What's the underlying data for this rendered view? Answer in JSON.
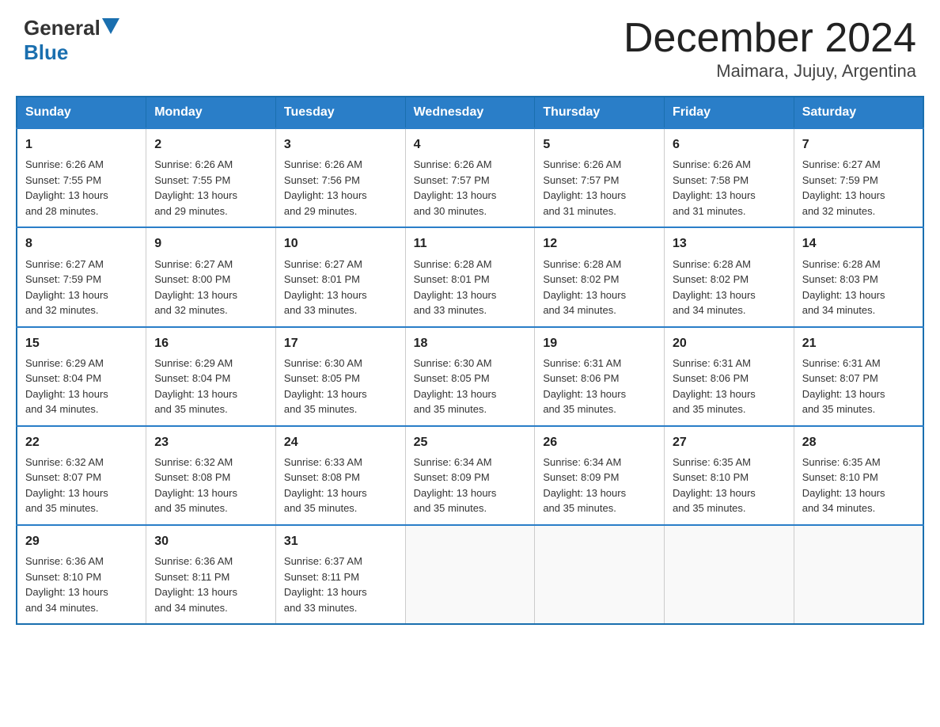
{
  "header": {
    "logo_general": "General",
    "logo_blue": "Blue",
    "main_title": "December 2024",
    "subtitle": "Maimara, Jujuy, Argentina"
  },
  "days_of_week": [
    "Sunday",
    "Monday",
    "Tuesday",
    "Wednesday",
    "Thursday",
    "Friday",
    "Saturday"
  ],
  "weeks": [
    [
      {
        "day": "1",
        "sunrise": "6:26 AM",
        "sunset": "7:55 PM",
        "daylight": "13 hours and 28 minutes."
      },
      {
        "day": "2",
        "sunrise": "6:26 AM",
        "sunset": "7:55 PM",
        "daylight": "13 hours and 29 minutes."
      },
      {
        "day": "3",
        "sunrise": "6:26 AM",
        "sunset": "7:56 PM",
        "daylight": "13 hours and 29 minutes."
      },
      {
        "day": "4",
        "sunrise": "6:26 AM",
        "sunset": "7:57 PM",
        "daylight": "13 hours and 30 minutes."
      },
      {
        "day": "5",
        "sunrise": "6:26 AM",
        "sunset": "7:57 PM",
        "daylight": "13 hours and 31 minutes."
      },
      {
        "day": "6",
        "sunrise": "6:26 AM",
        "sunset": "7:58 PM",
        "daylight": "13 hours and 31 minutes."
      },
      {
        "day": "7",
        "sunrise": "6:27 AM",
        "sunset": "7:59 PM",
        "daylight": "13 hours and 32 minutes."
      }
    ],
    [
      {
        "day": "8",
        "sunrise": "6:27 AM",
        "sunset": "7:59 PM",
        "daylight": "13 hours and 32 minutes."
      },
      {
        "day": "9",
        "sunrise": "6:27 AM",
        "sunset": "8:00 PM",
        "daylight": "13 hours and 32 minutes."
      },
      {
        "day": "10",
        "sunrise": "6:27 AM",
        "sunset": "8:01 PM",
        "daylight": "13 hours and 33 minutes."
      },
      {
        "day": "11",
        "sunrise": "6:28 AM",
        "sunset": "8:01 PM",
        "daylight": "13 hours and 33 minutes."
      },
      {
        "day": "12",
        "sunrise": "6:28 AM",
        "sunset": "8:02 PM",
        "daylight": "13 hours and 34 minutes."
      },
      {
        "day": "13",
        "sunrise": "6:28 AM",
        "sunset": "8:02 PM",
        "daylight": "13 hours and 34 minutes."
      },
      {
        "day": "14",
        "sunrise": "6:28 AM",
        "sunset": "8:03 PM",
        "daylight": "13 hours and 34 minutes."
      }
    ],
    [
      {
        "day": "15",
        "sunrise": "6:29 AM",
        "sunset": "8:04 PM",
        "daylight": "13 hours and 34 minutes."
      },
      {
        "day": "16",
        "sunrise": "6:29 AM",
        "sunset": "8:04 PM",
        "daylight": "13 hours and 35 minutes."
      },
      {
        "day": "17",
        "sunrise": "6:30 AM",
        "sunset": "8:05 PM",
        "daylight": "13 hours and 35 minutes."
      },
      {
        "day": "18",
        "sunrise": "6:30 AM",
        "sunset": "8:05 PM",
        "daylight": "13 hours and 35 minutes."
      },
      {
        "day": "19",
        "sunrise": "6:31 AM",
        "sunset": "8:06 PM",
        "daylight": "13 hours and 35 minutes."
      },
      {
        "day": "20",
        "sunrise": "6:31 AM",
        "sunset": "8:06 PM",
        "daylight": "13 hours and 35 minutes."
      },
      {
        "day": "21",
        "sunrise": "6:31 AM",
        "sunset": "8:07 PM",
        "daylight": "13 hours and 35 minutes."
      }
    ],
    [
      {
        "day": "22",
        "sunrise": "6:32 AM",
        "sunset": "8:07 PM",
        "daylight": "13 hours and 35 minutes."
      },
      {
        "day": "23",
        "sunrise": "6:32 AM",
        "sunset": "8:08 PM",
        "daylight": "13 hours and 35 minutes."
      },
      {
        "day": "24",
        "sunrise": "6:33 AM",
        "sunset": "8:08 PM",
        "daylight": "13 hours and 35 minutes."
      },
      {
        "day": "25",
        "sunrise": "6:34 AM",
        "sunset": "8:09 PM",
        "daylight": "13 hours and 35 minutes."
      },
      {
        "day": "26",
        "sunrise": "6:34 AM",
        "sunset": "8:09 PM",
        "daylight": "13 hours and 35 minutes."
      },
      {
        "day": "27",
        "sunrise": "6:35 AM",
        "sunset": "8:10 PM",
        "daylight": "13 hours and 35 minutes."
      },
      {
        "day": "28",
        "sunrise": "6:35 AM",
        "sunset": "8:10 PM",
        "daylight": "13 hours and 34 minutes."
      }
    ],
    [
      {
        "day": "29",
        "sunrise": "6:36 AM",
        "sunset": "8:10 PM",
        "daylight": "13 hours and 34 minutes."
      },
      {
        "day": "30",
        "sunrise": "6:36 AM",
        "sunset": "8:11 PM",
        "daylight": "13 hours and 34 minutes."
      },
      {
        "day": "31",
        "sunrise": "6:37 AM",
        "sunset": "8:11 PM",
        "daylight": "13 hours and 33 minutes."
      },
      null,
      null,
      null,
      null
    ]
  ],
  "labels": {
    "sunrise": "Sunrise:",
    "sunset": "Sunset:",
    "daylight": "Daylight:"
  }
}
